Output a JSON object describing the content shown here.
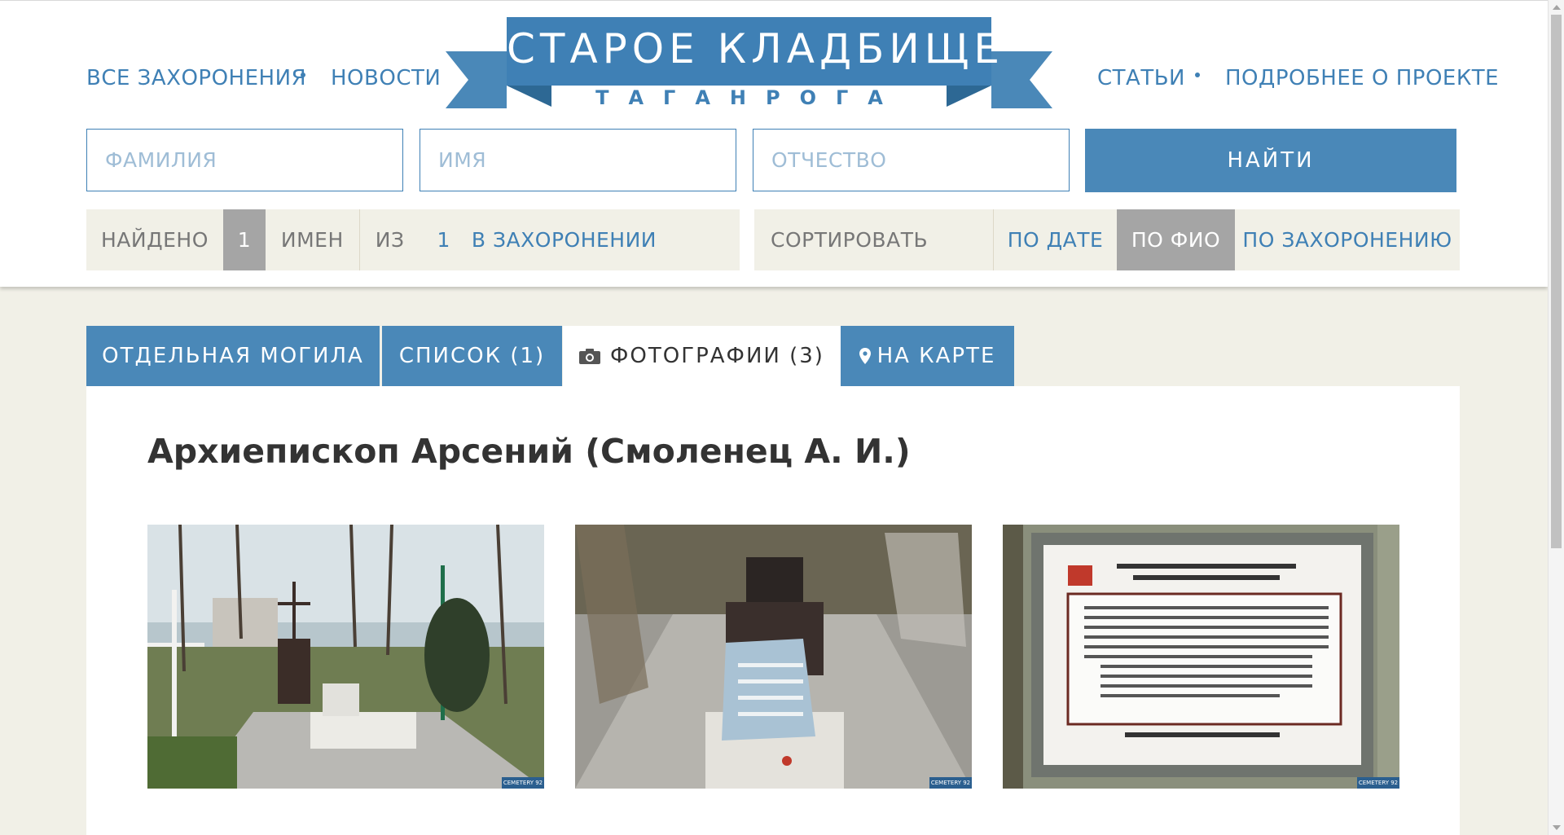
{
  "nav": {
    "left": [
      "ВСЕ ЗАХОРОНЕНИЯ",
      "НОВОСТИ"
    ],
    "right": [
      "СТАТЬИ",
      "ПОДРОБНЕЕ О ПРОЕКТЕ"
    ]
  },
  "logo": {
    "title": "СТАРОЕ КЛАДБИЩЕ",
    "subtitle": "ТАГАНРОГА"
  },
  "search": {
    "surname_placeholder": "ФАМИЛИЯ",
    "name_placeholder": "ИМЯ",
    "patronymic_placeholder": "ОТЧЕСТВО",
    "button_label": "НАЙТИ"
  },
  "results": {
    "found_label": "НАЙДЕНО",
    "found_count": "1",
    "names_label": "ИМЕН",
    "of_label": "ИЗ",
    "burial_count": "1",
    "burial_label": "В ЗАХОРОНЕНИИ"
  },
  "sort": {
    "label": "СОРТИРОВАТЬ",
    "options": [
      "ПО ДАТЕ",
      "ПО ФИО",
      "ПО ЗАХОРОНЕНИЮ"
    ],
    "active": "ПО ФИО"
  },
  "tabs": [
    {
      "label": "ОТДЕЛЬНАЯ МОГИЛА",
      "icon": ""
    },
    {
      "label": "СПИСОК (1)",
      "icon": ""
    },
    {
      "label": "ФОТОГРАФИИ (3)",
      "icon": "camera-icon"
    },
    {
      "label": "НА КАРТЕ",
      "icon": "map-pin-icon"
    }
  ],
  "active_tab": "ФОТОГРАФИИ (3)",
  "page_title": "Архиепископ Арсений (Смоленец А. И.)",
  "photos": [
    {
      "watermark": "CEMETERY 92"
    },
    {
      "watermark": "CEMETERY 92"
    },
    {
      "watermark": "CEMETERY 92"
    }
  ],
  "colors": {
    "brand_blue": "#4a88b8",
    "link_blue": "#3f80b5",
    "bar_bg": "#f1f0e7",
    "active_gray": "#a5a5a5"
  }
}
